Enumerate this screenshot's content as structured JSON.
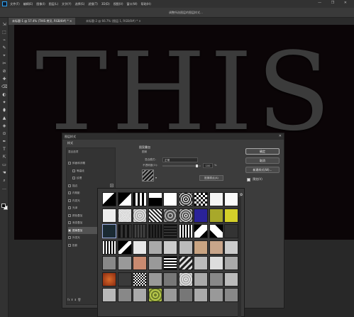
{
  "menubar": {
    "items": [
      "文件(F)",
      "编辑(E)",
      "图像(I)",
      "图层(L)",
      "文字(Y)",
      "选择(S)",
      "滤镜(T)",
      "3D(D)",
      "视图(V)",
      "窗口(W)",
      "帮助(H)"
    ],
    "window_controls": "— ❐ ✕"
  },
  "options_bar": {
    "hint": "调整所选图层的图层样式…"
  },
  "tabs": [
    {
      "label": "未标题-1 @ 57.4% (THIS 拷贝, RGB/8#) *  ×",
      "active": true
    },
    {
      "label": "未标题-2 @ 66.7% (图层 1, RGB/8#) *  ×",
      "active": false
    }
  ],
  "canvas": {
    "text": "THIS"
  },
  "dialog": {
    "title": "图层样式",
    "close": "✕",
    "styles_header": "样式",
    "blend_options": "混合选项",
    "style_items": [
      {
        "label": "斜面和浮雕",
        "sub": false,
        "checked": false,
        "plus": false
      },
      {
        "label": "等高线",
        "sub": true,
        "checked": false,
        "plus": false
      },
      {
        "label": "纹理",
        "sub": true,
        "checked": false,
        "plus": false
      },
      {
        "label": "描边",
        "sub": false,
        "checked": false,
        "plus": true
      },
      {
        "label": "内阴影",
        "sub": false,
        "checked": false,
        "plus": true
      },
      {
        "label": "内发光",
        "sub": false,
        "checked": false,
        "plus": false
      },
      {
        "label": "光泽",
        "sub": false,
        "checked": false,
        "plus": false
      },
      {
        "label": "颜色叠加",
        "sub": false,
        "checked": false,
        "plus": true
      },
      {
        "label": "渐变叠加",
        "sub": false,
        "checked": false,
        "plus": true
      },
      {
        "label": "图案叠加",
        "sub": false,
        "checked": true,
        "plus": false,
        "selected": true
      },
      {
        "label": "外发光",
        "sub": false,
        "checked": false,
        "plus": false
      },
      {
        "label": "投影",
        "sub": false,
        "checked": false,
        "plus": true
      }
    ],
    "list_footer": "fx  ⬆  ⬇  🗑",
    "panel_title": "图案叠加",
    "panel_sub": "图案",
    "blend_mode_label": "混合模式：",
    "blend_mode_value": "正常",
    "opacity_label": "不透明度(O)：",
    "opacity_value": "100",
    "opacity_unit": "%",
    "opacity_level": 1.0,
    "snap_origin": "贴紧原点(A)",
    "buttons": {
      "ok": "确定",
      "cancel": "取消",
      "new_style": "新建样式(W)...",
      "preview": "预览(V)"
    },
    "preview_checked": true
  },
  "picker": {
    "gear": "✿"
  },
  "tools": [
    "⇲",
    "⬚",
    "⌁",
    "✎",
    "⌖",
    "✂",
    "⊘",
    "✚",
    "⌫",
    "◐",
    "✦",
    "⬮",
    "▲",
    "◈",
    "⊙",
    "✒",
    "T",
    "⇱",
    "▭",
    "☚",
    "⌕",
    "…"
  ]
}
